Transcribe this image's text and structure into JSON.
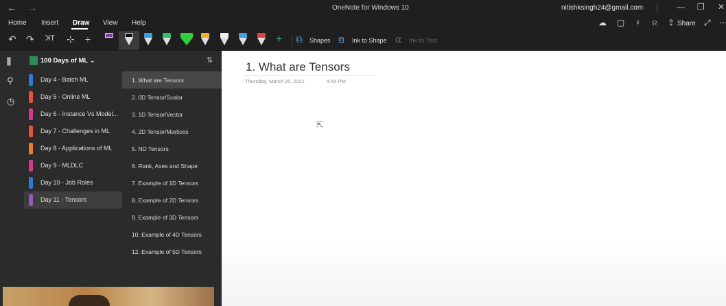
{
  "titlebar": {
    "title": "OneNote for Windows 10",
    "account": "nitishksingh24@gmail.com",
    "back": "←",
    "forward": "→",
    "minimize": "—",
    "restore": "❐",
    "close": "✕"
  },
  "ribbon": {
    "tabs": [
      "Home",
      "Insert",
      "Draw",
      "View",
      "Help"
    ],
    "active_tab": "Draw",
    "share_label": "Share"
  },
  "toolbar": {
    "shapes_label": "Shapes",
    "ink_to_shape_label": "Ink to Shape",
    "ink_to_text_label": "Ink to Text",
    "pen_colors": [
      "#7a3fa0",
      "#e6e6e6",
      "#3aa0e0",
      "#2fc06a",
      "#2fd23a",
      "#f0b030",
      "#f0f0f0",
      "#3aa0e0",
      "#e04040"
    ]
  },
  "notebook": {
    "name": "100 Days of ML"
  },
  "sections": [
    {
      "label": "Day 4 - Batch ML",
      "color": "#2f7bd8"
    },
    {
      "label": "Day 5 - Online ML",
      "color": "#e8533a"
    },
    {
      "label": "Day 6 - Instance Vs Model...",
      "color": "#d8388f"
    },
    {
      "label": "Day 7 - Challenges in ML",
      "color": "#e8533a"
    },
    {
      "label": "Day 8 - Applications of ML",
      "color": "#ee7a22"
    },
    {
      "label": "Day 9 - MLDLC",
      "color": "#d8388f"
    },
    {
      "label": "Day 10 - Job Roles",
      "color": "#2f7bd8"
    },
    {
      "label": "Day 11 - Tensors",
      "color": "#9b59b6"
    }
  ],
  "selected_section": "Day 11 - Tensors",
  "pages": [
    "1. What are Tensors",
    "2. 0D Tensor/Scalar",
    "3. 1D Tensor/Vector",
    "4. 2D Tensor/Martices",
    "5. ND Tensors",
    "6. Rank, Axes and Shape",
    "7. Example of 1D Tensors",
    "8. Example of 2D Tensors",
    "9. Example of 3D Tensors",
    "10. Example of 4D Tensors",
    "12. Example of 5D Tensors"
  ],
  "selected_page": "1. What are Tensors",
  "page": {
    "title": "1. What are Tensors",
    "date": "Thursday, March 25, 2021",
    "time": "4:44 PM"
  }
}
